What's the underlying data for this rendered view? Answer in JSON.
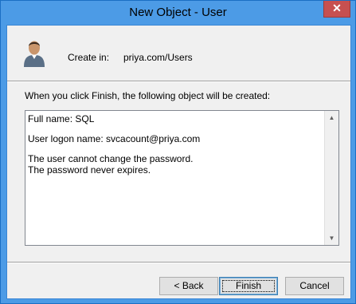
{
  "window": {
    "title": "New Object - User",
    "close_glyph": "✕"
  },
  "header": {
    "icon": "user-icon",
    "create_label": "Create in:",
    "create_path": "priya.com/Users"
  },
  "info_text": "When you click Finish, the following object will be created:",
  "summary": {
    "full_name": "Full name: SQL",
    "logon_name": "User logon name: svcacount@priya.com",
    "cannot_change": "The user cannot change the password.",
    "never_expires": "The password never expires."
  },
  "buttons": {
    "back": "< Back",
    "finish": "Finish",
    "cancel": "Cancel"
  },
  "colors": {
    "titlebar": "#4c9be6",
    "close": "#c75050",
    "client": "#f0f0f0"
  }
}
